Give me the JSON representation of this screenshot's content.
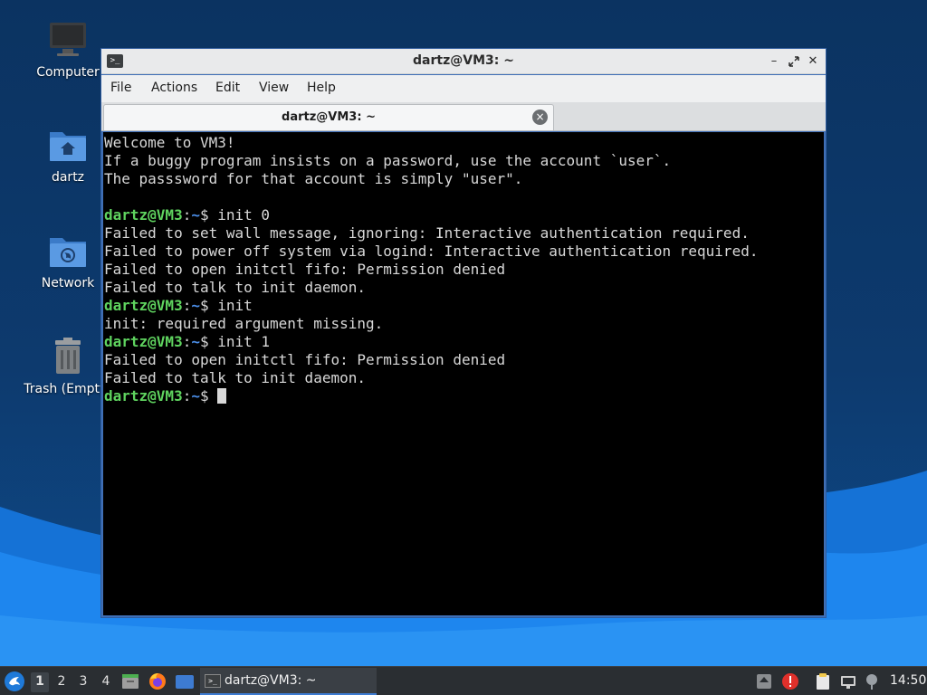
{
  "desktop": {
    "icons": [
      {
        "label": "Computer",
        "icon": "computer-icon"
      },
      {
        "label": "dartz",
        "icon": "home-folder-icon"
      },
      {
        "label": "Network",
        "icon": "network-folder-icon"
      },
      {
        "label": "Trash (Empty)",
        "icon": "trash-icon"
      }
    ]
  },
  "window": {
    "title": "dartz@VM3: ~",
    "menu": [
      "File",
      "Actions",
      "Edit",
      "View",
      "Help"
    ],
    "tab": {
      "label": "dartz@VM3: ~"
    },
    "terminal": {
      "lines": [
        {
          "text": "Welcome to VM3!"
        },
        {
          "text": "If a buggy program insists on a password, use the account `user`."
        },
        {
          "text": "The passsword for that account is simply \"user\"."
        },
        {
          "text": ""
        },
        {
          "prompt": {
            "user": "dartz@VM3",
            "sep": ":",
            "path": "~",
            "sym": "$ "
          },
          "cmd": "init 0"
        },
        {
          "text": "Failed to set wall message, ignoring: Interactive authentication required."
        },
        {
          "text": "Failed to power off system via logind: Interactive authentication required."
        },
        {
          "text": "Failed to open initctl fifo: Permission denied"
        },
        {
          "text": "Failed to talk to init daemon."
        },
        {
          "prompt": {
            "user": "dartz@VM3",
            "sep": ":",
            "path": "~",
            "sym": "$ "
          },
          "cmd": "init"
        },
        {
          "text": "init: required argument missing."
        },
        {
          "prompt": {
            "user": "dartz@VM3",
            "sep": ":",
            "path": "~",
            "sym": "$ "
          },
          "cmd": "init 1"
        },
        {
          "text": "Failed to open initctl fifo: Permission denied"
        },
        {
          "text": "Failed to talk to init daemon."
        },
        {
          "prompt": {
            "user": "dartz@VM3",
            "sep": ":",
            "path": "~",
            "sym": "$ "
          },
          "cmd": "",
          "cursor": true
        }
      ]
    }
  },
  "taskbar": {
    "workspaces": [
      "1",
      "2",
      "3",
      "4"
    ],
    "active_workspace": "1",
    "launchers": [
      "file-manager-icon",
      "firefox-icon",
      "desktop-icon"
    ],
    "task": {
      "label": "dartz@VM3: ~"
    },
    "tray": [
      "update-arrow-icon",
      "alert-icon",
      "clipboard-icon",
      "network-icon",
      "bluetooth-icon"
    ],
    "clock": "14:50"
  },
  "colors": {
    "prompt_user": "#5fd35f",
    "prompt_path": "#4b8ee8",
    "terminal_bg": "#000000",
    "terminal_fg": "#d8d8d8",
    "accent": "#3d7bd1"
  }
}
